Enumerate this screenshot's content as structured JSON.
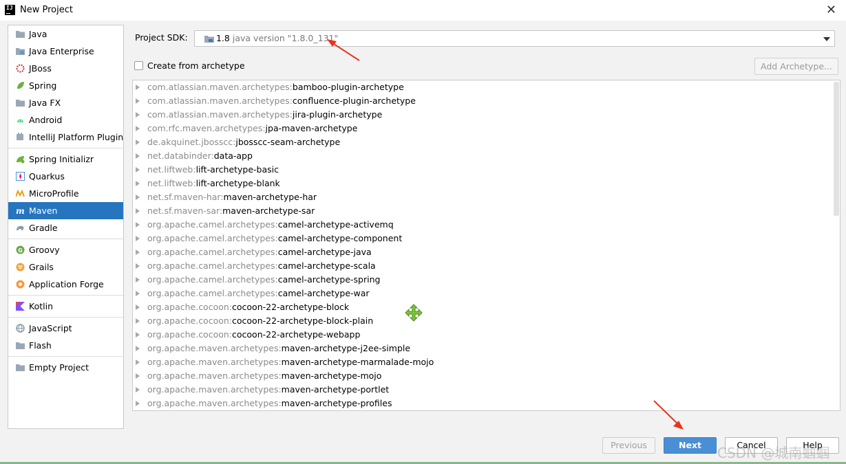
{
  "window": {
    "title": "New Project",
    "close_glyph": "✕"
  },
  "sidebar": {
    "groups": [
      [
        {
          "label": "Java",
          "icon": "folder-icon"
        },
        {
          "label": "Java Enterprise",
          "icon": "java-enterprise-icon"
        },
        {
          "label": "JBoss",
          "icon": "jboss-icon"
        },
        {
          "label": "Spring",
          "icon": "spring-leaf-icon"
        },
        {
          "label": "Java FX",
          "icon": "folder-icon"
        },
        {
          "label": "Android",
          "icon": "android-icon"
        },
        {
          "label": "IntelliJ Platform Plugin",
          "icon": "plugin-icon"
        }
      ],
      [
        {
          "label": "Spring Initializr",
          "icon": "spring-initializr-icon"
        },
        {
          "label": "Quarkus",
          "icon": "quarkus-icon"
        },
        {
          "label": "MicroProfile",
          "icon": "microprofile-icon"
        },
        {
          "label": "Maven",
          "icon": "maven-icon",
          "selected": true
        },
        {
          "label": "Gradle",
          "icon": "gradle-icon"
        }
      ],
      [
        {
          "label": "Groovy",
          "icon": "groovy-icon"
        },
        {
          "label": "Grails",
          "icon": "grails-icon"
        },
        {
          "label": "Application Forge",
          "icon": "application-forge-icon"
        }
      ],
      [
        {
          "label": "Kotlin",
          "icon": "kotlin-icon"
        }
      ],
      [
        {
          "label": "JavaScript",
          "icon": "javascript-icon"
        },
        {
          "label": "Flash",
          "icon": "folder-icon"
        }
      ],
      [
        {
          "label": "Empty Project",
          "icon": "folder-icon"
        }
      ]
    ]
  },
  "sdk": {
    "label": "Project SDK:",
    "value": "1.8",
    "detail": "java version \"1.8.0_131\""
  },
  "archetype": {
    "checkbox_label": "Create from archetype",
    "checked": false,
    "add_button": "Add Archetype..."
  },
  "archetypes": [
    {
      "group": "com.atlassian.maven.archetypes:",
      "artifact": "bamboo-plugin-archetype"
    },
    {
      "group": "com.atlassian.maven.archetypes:",
      "artifact": "confluence-plugin-archetype"
    },
    {
      "group": "com.atlassian.maven.archetypes:",
      "artifact": "jira-plugin-archetype"
    },
    {
      "group": "com.rfc.maven.archetypes:",
      "artifact": "jpa-maven-archetype"
    },
    {
      "group": "de.akquinet.jbosscc:",
      "artifact": "jbosscc-seam-archetype"
    },
    {
      "group": "net.databinder:",
      "artifact": "data-app"
    },
    {
      "group": "net.liftweb:",
      "artifact": "lift-archetype-basic"
    },
    {
      "group": "net.liftweb:",
      "artifact": "lift-archetype-blank"
    },
    {
      "group": "net.sf.maven-har:",
      "artifact": "maven-archetype-har"
    },
    {
      "group": "net.sf.maven-sar:",
      "artifact": "maven-archetype-sar"
    },
    {
      "group": "org.apache.camel.archetypes:",
      "artifact": "camel-archetype-activemq"
    },
    {
      "group": "org.apache.camel.archetypes:",
      "artifact": "camel-archetype-component"
    },
    {
      "group": "org.apache.camel.archetypes:",
      "artifact": "camel-archetype-java"
    },
    {
      "group": "org.apache.camel.archetypes:",
      "artifact": "camel-archetype-scala"
    },
    {
      "group": "org.apache.camel.archetypes:",
      "artifact": "camel-archetype-spring"
    },
    {
      "group": "org.apache.camel.archetypes:",
      "artifact": "camel-archetype-war"
    },
    {
      "group": "org.apache.cocoon:",
      "artifact": "cocoon-22-archetype-block"
    },
    {
      "group": "org.apache.cocoon:",
      "artifact": "cocoon-22-archetype-block-plain"
    },
    {
      "group": "org.apache.cocoon:",
      "artifact": "cocoon-22-archetype-webapp"
    },
    {
      "group": "org.apache.maven.archetypes:",
      "artifact": "maven-archetype-j2ee-simple"
    },
    {
      "group": "org.apache.maven.archetypes:",
      "artifact": "maven-archetype-marmalade-mojo"
    },
    {
      "group": "org.apache.maven.archetypes:",
      "artifact": "maven-archetype-mojo"
    },
    {
      "group": "org.apache.maven.archetypes:",
      "artifact": "maven-archetype-portlet"
    },
    {
      "group": "org.apache.maven.archetypes:",
      "artifact": "maven-archetype-profiles"
    }
  ],
  "buttons": {
    "previous": "Previous",
    "next": "Next",
    "cancel": "Cancel",
    "help": "Help"
  },
  "watermark": "CSDN @城南蝈蝈",
  "colors": {
    "selection": "#2675bf",
    "primary_button": "#4a8fd6",
    "annotation_arrow": "#e8331e"
  }
}
